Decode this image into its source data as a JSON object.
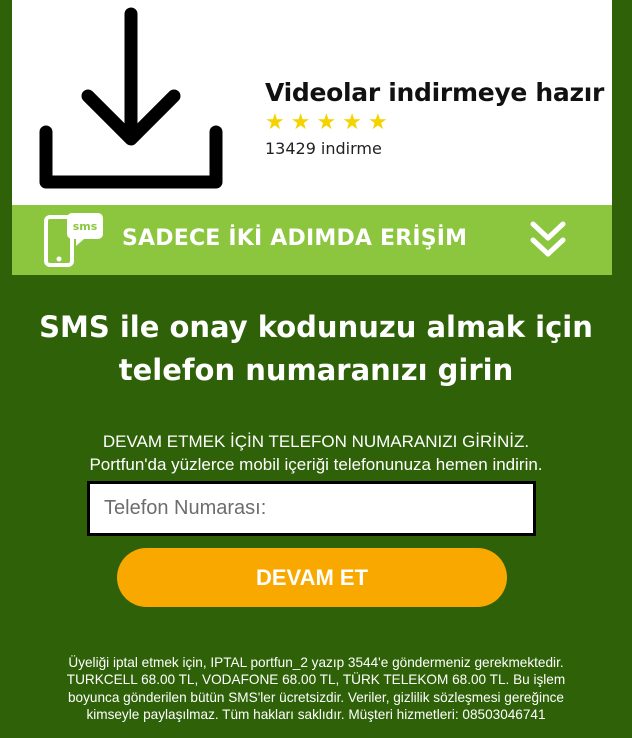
{
  "hero": {
    "icon": "download-icon",
    "title": "Videolar indirmeye hazır",
    "rating_stars": 5,
    "downloads_count": "13429",
    "downloads_label": "indirme"
  },
  "access_bar": {
    "sms_icon": "sms-phone-icon",
    "sms_badge": "sms",
    "text": "SADECE İKİ ADIMDA ERİŞİM",
    "arrow_icon": "double-chevron-down-icon"
  },
  "headline": {
    "line1": "SMS ile onay kodunuzu almak için",
    "line2": "telefon numaranızı girin"
  },
  "instructions": {
    "line1": "DEVAM ETMEK İÇİN TELEFON NUMARANIZI GİRİNİZ.",
    "line2": "Portfun'da yüzlerce mobil içeriği telefonunuza hemen indirin."
  },
  "form": {
    "phone_placeholder": "Telefon Numarası:",
    "phone_value": "",
    "submit_label": "DEVAM ET"
  },
  "footer": {
    "line1": "Üyeliği iptal etmek için, IPTAL portfun_2 yazıp 3544'e göndermeniz gerekmektedir.",
    "line2": "TURKCELL 68.00 TL, VODAFONE 68.00 TL, TÜRK TELEKOM 68.00 TL. Bu işlem",
    "line3": "boyunca gönderilen bütün SMS'ler ücretsizdir. Veriler, gizlilik sözleşmesi gereğince",
    "line4": "kimseyle paylaşılmaz. Tüm hakları saklıdır. Müşteri hizmetleri: 08503046741"
  },
  "colors": {
    "background": "#2f6208",
    "access_bar": "#8cc63f",
    "button": "#f9a800",
    "stars": "#f5d300"
  }
}
